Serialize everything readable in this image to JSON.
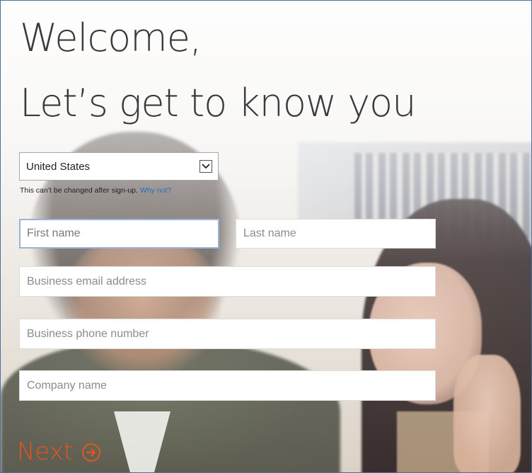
{
  "header": {
    "line1": "Welcome,",
    "line2": "Let’s get to know you"
  },
  "country": {
    "selected": "United States",
    "icon": "chevron-down-icon"
  },
  "notice": {
    "text": "This can’t be changed after sign-up.",
    "link": "Why not?"
  },
  "form": {
    "first_name": {
      "placeholder": "First name",
      "value": ""
    },
    "last_name": {
      "placeholder": "Last name",
      "value": ""
    },
    "email": {
      "placeholder": "Business email address",
      "value": ""
    },
    "phone": {
      "placeholder": "Business phone number",
      "value": ""
    },
    "company": {
      "placeholder": "Company name",
      "value": ""
    }
  },
  "next": {
    "label": "Next",
    "icon": "arrow-right-circle-icon"
  },
  "colors": {
    "accent": "#e2551e",
    "link": "#2a6db5",
    "heading": "#3a3a3a",
    "focus_border": "#9bb3d6"
  }
}
